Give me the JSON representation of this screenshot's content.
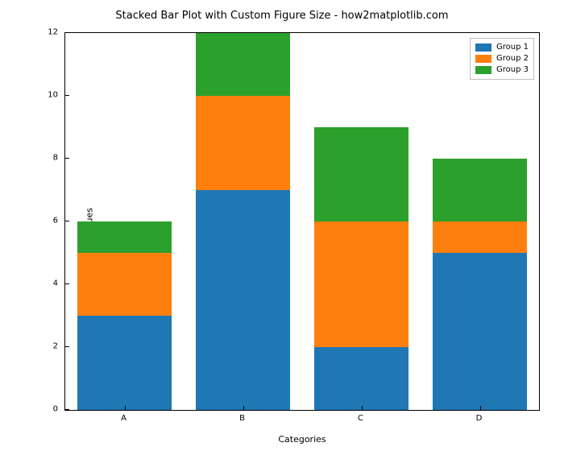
{
  "chart_data": {
    "type": "bar",
    "stacked": true,
    "title": "Stacked Bar Plot with Custom Figure Size - how2matplotlib.com",
    "xlabel": "Categories",
    "ylabel": "Values",
    "categories": [
      "A",
      "B",
      "C",
      "D"
    ],
    "series": [
      {
        "name": "Group 1",
        "values": [
          3,
          7,
          2,
          5
        ],
        "color": "#1f77b4"
      },
      {
        "name": "Group 2",
        "values": [
          2,
          3,
          4,
          1
        ],
        "color": "#ff7f0e"
      },
      {
        "name": "Group 3",
        "values": [
          1,
          2,
          3,
          2
        ],
        "color": "#2ca02c"
      }
    ],
    "ylim": [
      0,
      12
    ],
    "yticks": [
      0,
      2,
      4,
      6,
      8,
      10,
      12
    ]
  }
}
